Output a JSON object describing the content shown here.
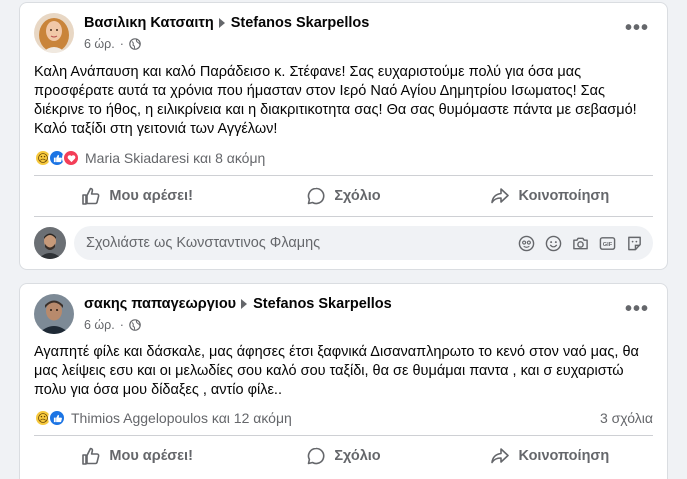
{
  "posts": [
    {
      "author": "Βασιλικη Κατσαιτη",
      "target": "Stefanos Skarpellos",
      "time": "6 ώρ.",
      "text": "Καλη Ανάπαυση και καλό Παράδεισο κ. Στέφανε! Σας ευχαριστούμε πολύ για όσα μας προσφέρατε αυτά τα χρόνια που ήμασταν στον Ιερό Ναό Αγίου Δημητρίου Ισωματος! Σας διέκρινε το ήθος, η ειλικρίνεια και η διακριτικοτητα σας! Θα σας θυμόμαστε πάντα με σεβασμό! Καλό ταξίδι στη γειτονιά των Αγγέλων!",
      "reactions_text": "Maria Skiadaresi και 8 ακόμη",
      "reaction_icons": [
        "sad",
        "like",
        "love"
      ],
      "comments_count": ""
    },
    {
      "author": "σακης παπαγεωργιου",
      "target": "Stefanos Skarpellos",
      "time": "6 ώρ.",
      "text": "Αγαπητέ φίλε και δάσκαλε, μας άφησες έτσι ξαφνικά Δισαναπληρωτο το κενό στον ναό μας, θα μας λείψεις εσυ και οι μελωδίες σου καλό σου ταξίδι, θα σε θυμάμαι παντα , και σ ευχαριστώ πολυ για όσα μου δίδαξες , αντίο φίλε..",
      "reactions_text": "Thimios Aggelopoulos και 12 ακόμη",
      "reaction_icons": [
        "sad",
        "like"
      ],
      "comments_count": "3 σχόλια"
    }
  ],
  "actions": {
    "like": "Μου αρέσει!",
    "comment": "Σχόλιο",
    "share": "Κοινοποίηση"
  },
  "composer": {
    "placeholder": "Σχολιάστε ως Κωνσταντινος Φλαμης"
  },
  "colors": {
    "background": "#f0f2f5",
    "like_blue": "#1b74e4",
    "love_red": "#f33e58",
    "sad_yellow": "#f7c93e",
    "secondary_text": "#65676b"
  }
}
